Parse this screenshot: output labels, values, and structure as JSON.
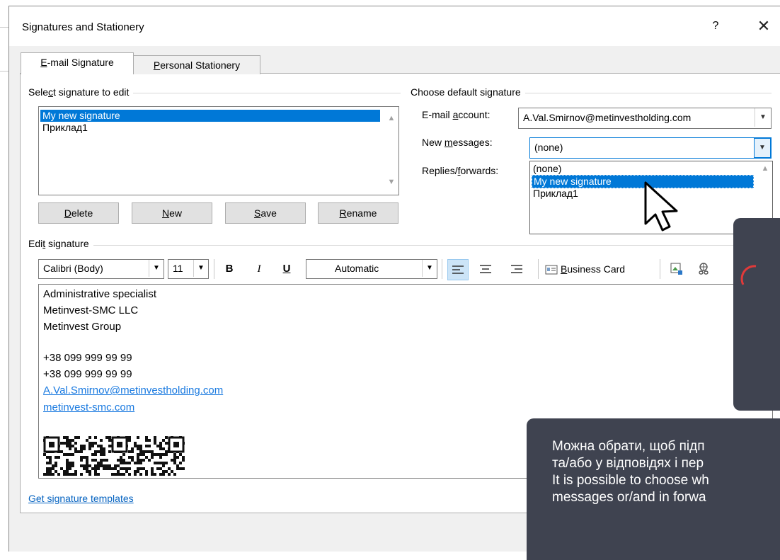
{
  "window": {
    "title": "Signatures and Stationery",
    "help": "?",
    "close": "✕"
  },
  "tabs": [
    {
      "label_pre": "",
      "label_key": "E",
      "label_post": "-mail Signature"
    },
    {
      "label_pre": "",
      "label_key": "P",
      "label_post": "ersonal Stationery"
    }
  ],
  "select_signature": {
    "group_label_pre": "Sele",
    "group_label_key": "c",
    "group_label_post": "t signature to edit",
    "items": [
      "My new signature",
      "Приклад1"
    ],
    "selected": "My new signature"
  },
  "buttons": {
    "delete": {
      "key": "D",
      "rest": "elete"
    },
    "new": {
      "key": "N",
      "rest": "ew"
    },
    "save": {
      "key": "S",
      "rest": "ave"
    },
    "rename": {
      "key": "R",
      "rest": "ename"
    }
  },
  "default_signature": {
    "group_label": "Choose default signature",
    "email_account_label_pre": "E-mail ",
    "email_account_label_key": "a",
    "email_account_label_post": "ccount:",
    "email_account_value": "A.Val.Smirnov@metinvestholding.com",
    "new_messages_label_pre": "New ",
    "new_messages_label_key": "m",
    "new_messages_label_post": "essages:",
    "new_messages_value": "(none)",
    "replies_label_pre": "Replies/",
    "replies_label_key": "f",
    "replies_label_post": "orwards:",
    "dropdown_options": [
      "(none)",
      "My new signature",
      "Приклад1"
    ],
    "dropdown_highlighted": "My new signature"
  },
  "edit_signature": {
    "group_label_pre": "Edi",
    "group_label_key": "t",
    "group_label_post": " signature",
    "font": "Calibri (Body)",
    "size": "11",
    "bold": "B",
    "italic": "I",
    "underline": "U",
    "color": "Automatic",
    "business_card_key": "B",
    "business_card_rest": "usiness Card"
  },
  "signature_body": {
    "lines": [
      "Administrative specialist",
      "Metinvest-SMC LLC",
      "Metinvest Group"
    ],
    "phones": [
      "+38 099 999 99 99",
      "+38 099 999 99 99"
    ],
    "email": "A.Val.Smirnov@metinvestholding.com",
    "website": "metinvest-smc.com"
  },
  "templates_link": "Get signature templates",
  "tooltip": {
    "lines": [
      "Можна обрати, щоб підп",
      "та/або у відповідях і пер",
      "It is possible to choose wh",
      "messages or/and in forwa"
    ]
  },
  "colors": {
    "selection": "#0078d7",
    "link": "#0563c1",
    "overlay": "#3f4350"
  }
}
